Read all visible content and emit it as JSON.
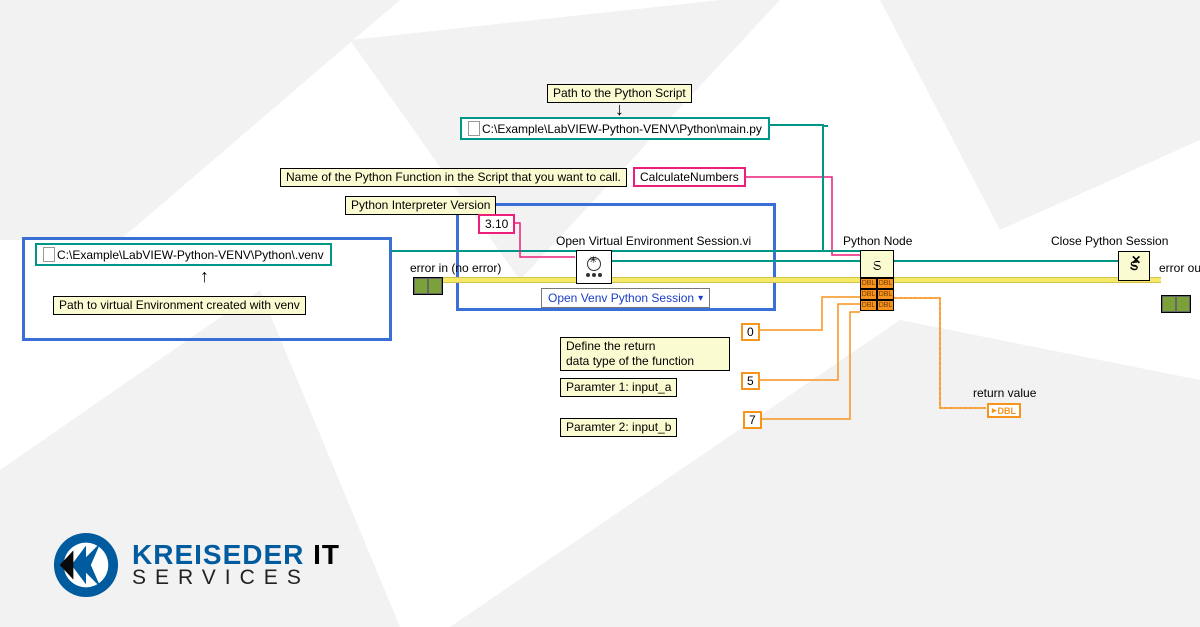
{
  "annotations": {
    "venv_path_tip": "Path to virtual Environment created with venv",
    "interpreter_tip": "Python Interpreter Version",
    "script_path_tip": "Path to the Python Script",
    "func_name_tip": "Name of the Python Function in the Script that you want to call.",
    "return_type_tip_l1": "Define the return",
    "return_type_tip_l2": "data type of the function",
    "param1_tip": "Paramter 1: input_a",
    "param2_tip": "Paramter 2: input_b"
  },
  "constants": {
    "venv_path": "C:\\Example\\LabVIEW-Python-VENV\\Python\\.venv",
    "script_path": "C:\\Example\\LabVIEW-Python-VENV\\Python\\main.py",
    "interpreter_version": "3.10",
    "function_name": "CalculateNumbers",
    "return_type_init": "0",
    "param1": "5",
    "param2": "7"
  },
  "labels": {
    "error_in": "error in (no error)",
    "open_session_vi": "Open Virtual Environment Session.vi",
    "open_session_poly": "Open Venv Python Session",
    "python_node": "Python Node",
    "close_session": "Close Python Session",
    "error_out": "error out",
    "return_value": "return value"
  },
  "terminals": {
    "dbl": "DBL"
  },
  "logo": {
    "line1a": "KREISEDER",
    "line1b": "IT",
    "line2": "SERVICES"
  }
}
